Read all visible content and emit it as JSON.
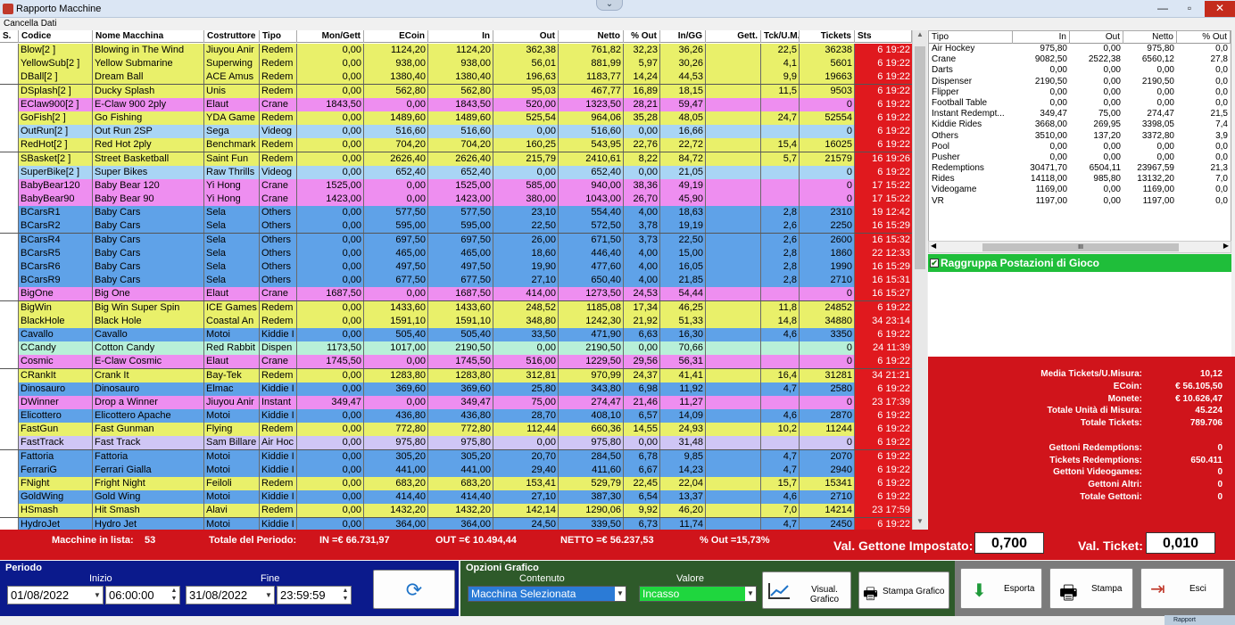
{
  "window": {
    "title": "Rapporto Macchine",
    "cancella": "Cancella Dati",
    "minimize": "—",
    "maximize": "▫",
    "close": "✕",
    "collapse": "⌄"
  },
  "grid": {
    "headers": [
      "S.",
      "Codice",
      "Nome Macchina",
      "Costruttore",
      "Tipo",
      "Mon/Gett",
      "ECoin",
      "In",
      "Out",
      "Netto",
      "% Out",
      "In/GG",
      "Gett.",
      "Tck/U.M.",
      "Tickets",
      "Sts"
    ],
    "rows": [
      {
        "color": "#e9f06a",
        "c": [
          "",
          "Blow[2 ]",
          "Blowing in The Wind",
          "Jiuyou Anir",
          "Redem",
          "0,00",
          "1124,20",
          "1124,20",
          "362,38",
          "761,82",
          "32,23",
          "36,26",
          "",
          "22,5",
          "36238",
          "6 19:22"
        ]
      },
      {
        "color": "#e9f06a",
        "c": [
          "",
          "YellowSub[2 ]",
          "Yellow Submarine",
          "Superwing",
          "Redem",
          "0,00",
          "938,00",
          "938,00",
          "56,01",
          "881,99",
          "5,97",
          "30,26",
          "",
          "4,1",
          "5601",
          "6 19:22"
        ]
      },
      {
        "color": "#e9f06a",
        "c": [
          "",
          "DBall[2 ]",
          "Dream Ball",
          "ACE Amus",
          "Redem",
          "0,00",
          "1380,40",
          "1380,40",
          "196,63",
          "1183,77",
          "14,24",
          "44,53",
          "",
          "9,9",
          "19663",
          "6 19:22"
        ]
      },
      {
        "color": "#e9f06a",
        "c": [
          "",
          "DSplash[2 ]",
          "Ducky Splash",
          "Unis",
          "Redem",
          "0,00",
          "562,80",
          "562,80",
          "95,03",
          "467,77",
          "16,89",
          "18,15",
          "",
          "11,5",
          "9503",
          "6 19:22"
        ]
      },
      {
        "color": "#ee8ef0",
        "c": [
          "",
          "EClaw900[2 ]",
          "E-Claw 900 2ply",
          "Elaut",
          "Crane",
          "1843,50",
          "0,00",
          "1843,50",
          "520,00",
          "1323,50",
          "28,21",
          "59,47",
          "",
          "",
          "0",
          "6 19:22"
        ]
      },
      {
        "color": "#e9f06a",
        "c": [
          "",
          "GoFish[2 ]",
          "Go Fishing",
          "YDA Game",
          "Redem",
          "0,00",
          "1489,60",
          "1489,60",
          "525,54",
          "964,06",
          "35,28",
          "48,05",
          "",
          "24,7",
          "52554",
          "6 19:22"
        ]
      },
      {
        "color": "#a9d5f5",
        "c": [
          "",
          "OutRun[2 ]",
          "Out Run 2SP",
          "Sega",
          "Videog",
          "0,00",
          "516,60",
          "516,60",
          "0,00",
          "516,60",
          "0,00",
          "16,66",
          "",
          "",
          "0",
          "6 19:22"
        ]
      },
      {
        "color": "#e9f06a",
        "c": [
          "",
          "RedHot[2 ]",
          "Red Hot 2ply",
          "Benchmark",
          "Redem",
          "0,00",
          "704,20",
          "704,20",
          "160,25",
          "543,95",
          "22,76",
          "22,72",
          "",
          "15,4",
          "16025",
          "6 19:22"
        ]
      },
      {
        "color": "#e9f06a",
        "c": [
          "",
          "SBasket[2 ]",
          "Street Basketball",
          "Saint Fun",
          "Redem",
          "0,00",
          "2626,40",
          "2626,40",
          "215,79",
          "2410,61",
          "8,22",
          "84,72",
          "",
          "5,7",
          "21579",
          "16 19:26"
        ]
      },
      {
        "color": "#a9d5f5",
        "c": [
          "",
          "SuperBike[2 ]",
          "Super Bikes",
          "Raw Thrills",
          "Videog",
          "0,00",
          "652,40",
          "652,40",
          "0,00",
          "652,40",
          "0,00",
          "21,05",
          "",
          "",
          "0",
          "6 19:22"
        ]
      },
      {
        "color": "#ee8ef0",
        "c": [
          "",
          "BabyBear120",
          "Baby Bear 120",
          "Yi Hong",
          "Crane",
          "1525,00",
          "0,00",
          "1525,00",
          "585,00",
          "940,00",
          "38,36",
          "49,19",
          "",
          "",
          "0",
          "17 15:22"
        ]
      },
      {
        "color": "#ee8ef0",
        "c": [
          "",
          "BabyBear90",
          "Baby Bear 90",
          "Yi Hong",
          "Crane",
          "1423,00",
          "0,00",
          "1423,00",
          "380,00",
          "1043,00",
          "26,70",
          "45,90",
          "",
          "",
          "0",
          "17 15:22"
        ]
      },
      {
        "color": "#5fa2e8",
        "c": [
          "",
          "BCarsR1",
          "Baby Cars",
          "Sela",
          "Others",
          "0,00",
          "577,50",
          "577,50",
          "23,10",
          "554,40",
          "4,00",
          "18,63",
          "",
          "2,8",
          "2310",
          "19 12:42"
        ]
      },
      {
        "color": "#5fa2e8",
        "c": [
          "",
          "BCarsR2",
          "Baby Cars",
          "Sela",
          "Others",
          "0,00",
          "595,00",
          "595,00",
          "22,50",
          "572,50",
          "3,78",
          "19,19",
          "",
          "2,6",
          "2250",
          "16 15:29"
        ]
      },
      {
        "color": "#5fa2e8",
        "c": [
          "",
          "BCarsR4",
          "Baby Cars",
          "Sela",
          "Others",
          "0,00",
          "697,50",
          "697,50",
          "26,00",
          "671,50",
          "3,73",
          "22,50",
          "",
          "2,6",
          "2600",
          "16 15:32"
        ]
      },
      {
        "color": "#5fa2e8",
        "c": [
          "",
          "BCarsR5",
          "Baby Cars",
          "Sela",
          "Others",
          "0,00",
          "465,00",
          "465,00",
          "18,60",
          "446,40",
          "4,00",
          "15,00",
          "",
          "2,8",
          "1860",
          "22 12:33"
        ]
      },
      {
        "color": "#5fa2e8",
        "c": [
          "",
          "BCarsR6",
          "Baby Cars",
          "Sela",
          "Others",
          "0,00",
          "497,50",
          "497,50",
          "19,90",
          "477,60",
          "4,00",
          "16,05",
          "",
          "2,8",
          "1990",
          "16 15:29"
        ]
      },
      {
        "color": "#5fa2e8",
        "c": [
          "",
          "BCarsR9",
          "Baby Cars",
          "Sela",
          "Others",
          "0,00",
          "677,50",
          "677,50",
          "27,10",
          "650,40",
          "4,00",
          "21,85",
          "",
          "2,8",
          "2710",
          "16 15:31"
        ]
      },
      {
        "color": "#ee8ef0",
        "c": [
          "",
          "BigOne",
          "Big One",
          "Elaut",
          "Crane",
          "1687,50",
          "0,00",
          "1687,50",
          "414,00",
          "1273,50",
          "24,53",
          "54,44",
          "",
          "",
          "0",
          "16 15:27"
        ]
      },
      {
        "color": "#e9f06a",
        "c": [
          "",
          "BigWin",
          "Big Win Super Spin",
          "ICE Games",
          "Redem",
          "0,00",
          "1433,60",
          "1433,60",
          "248,52",
          "1185,08",
          "17,34",
          "46,25",
          "",
          "11,8",
          "24852",
          "6 19:22"
        ]
      },
      {
        "color": "#e9f06a",
        "c": [
          "",
          "BlackHole",
          "Black Hole",
          "Coastal An",
          "Redem",
          "0,00",
          "1591,10",
          "1591,10",
          "348,80",
          "1242,30",
          "21,92",
          "51,33",
          "",
          "14,8",
          "34880",
          "34 23:14"
        ]
      },
      {
        "color": "#5fa2e8",
        "c": [
          "",
          "Cavallo",
          "Cavallo",
          "Motoi",
          "Kiddie I",
          "0,00",
          "505,40",
          "505,40",
          "33,50",
          "471,90",
          "6,63",
          "16,30",
          "",
          "4,6",
          "3350",
          "6 19:22"
        ]
      },
      {
        "color": "#b8f0d8",
        "c": [
          "",
          "CCandy",
          "Cotton Candy",
          "Red Rabbit",
          "Dispen",
          "1173,50",
          "1017,00",
          "2190,50",
          "0,00",
          "2190,50",
          "0,00",
          "70,66",
          "",
          "",
          "0",
          "24 11:39"
        ]
      },
      {
        "color": "#ee8ef0",
        "c": [
          "",
          "Cosmic",
          "E-Claw Cosmic",
          "Elaut",
          "Crane",
          "1745,50",
          "0,00",
          "1745,50",
          "516,00",
          "1229,50",
          "29,56",
          "56,31",
          "",
          "",
          "0",
          "6 19:22"
        ]
      },
      {
        "color": "#e9f06a",
        "c": [
          "",
          "CRankIt",
          "Crank It",
          "Bay-Tek",
          "Redem",
          "0,00",
          "1283,80",
          "1283,80",
          "312,81",
          "970,99",
          "24,37",
          "41,41",
          "",
          "16,4",
          "31281",
          "34 21:21"
        ]
      },
      {
        "color": "#5fa2e8",
        "c": [
          "",
          "Dinosauro",
          "Dinosauro",
          "Elmac",
          "Kiddie I",
          "0,00",
          "369,60",
          "369,60",
          "25,80",
          "343,80",
          "6,98",
          "11,92",
          "",
          "4,7",
          "2580",
          "6 19:22"
        ]
      },
      {
        "color": "#ee8ef0",
        "c": [
          "",
          "DWinner",
          "Drop a Winner",
          "Jiuyou Anir",
          "Instant",
          "349,47",
          "0,00",
          "349,47",
          "75,00",
          "274,47",
          "21,46",
          "11,27",
          "",
          "",
          "0",
          "23 17:39"
        ]
      },
      {
        "color": "#5fa2e8",
        "c": [
          "",
          "Elicottero",
          "Elicottero Apache",
          "Motoi",
          "Kiddie I",
          "0,00",
          "436,80",
          "436,80",
          "28,70",
          "408,10",
          "6,57",
          "14,09",
          "",
          "4,6",
          "2870",
          "6 19:22"
        ]
      },
      {
        "color": "#e9f06a",
        "c": [
          "",
          "FastGun",
          "Fast Gunman",
          "Flying",
          "Redem",
          "0,00",
          "772,80",
          "772,80",
          "112,44",
          "660,36",
          "14,55",
          "24,93",
          "",
          "10,2",
          "11244",
          "6 19:22"
        ]
      },
      {
        "color": "#cfc6f5",
        "c": [
          "",
          "FastTrack",
          "Fast Track",
          "Sam Billare",
          "Air Hoc",
          "0,00",
          "975,80",
          "975,80",
          "0,00",
          "975,80",
          "0,00",
          "31,48",
          "",
          "",
          "0",
          "6 19:22"
        ]
      },
      {
        "color": "#5fa2e8",
        "c": [
          "",
          "Fattoria",
          "Fattoria",
          "Motoi",
          "Kiddie I",
          "0,00",
          "305,20",
          "305,20",
          "20,70",
          "284,50",
          "6,78",
          "9,85",
          "",
          "4,7",
          "2070",
          "6 19:22"
        ]
      },
      {
        "color": "#5fa2e8",
        "c": [
          "",
          "FerrariG",
          "Ferrari Gialla",
          "Motoi",
          "Kiddie I",
          "0,00",
          "441,00",
          "441,00",
          "29,40",
          "411,60",
          "6,67",
          "14,23",
          "",
          "4,7",
          "2940",
          "6 19:22"
        ]
      },
      {
        "color": "#e9f06a",
        "c": [
          "",
          "FNight",
          "Fright Night",
          "Feiloli",
          "Redem",
          "0,00",
          "683,20",
          "683,20",
          "153,41",
          "529,79",
          "22,45",
          "22,04",
          "",
          "15,7",
          "15341",
          "6 19:22"
        ]
      },
      {
        "color": "#5fa2e8",
        "c": [
          "",
          "GoldWing",
          "Gold Wing",
          "Motoi",
          "Kiddie I",
          "0,00",
          "414,40",
          "414,40",
          "27,10",
          "387,30",
          "6,54",
          "13,37",
          "",
          "4,6",
          "2710",
          "6 19:22"
        ]
      },
      {
        "color": "#e9f06a",
        "c": [
          "",
          "HSmash",
          "Hit Smash",
          "Alavi",
          "Redem",
          "0,00",
          "1432,20",
          "1432,20",
          "142,14",
          "1290,06",
          "9,92",
          "46,20",
          "",
          "7,0",
          "14214",
          "23 17:59"
        ]
      },
      {
        "color": "#5fa2e8",
        "c": [
          "",
          "HydroJet",
          "Hydro Jet",
          "Motoi",
          "Kiddie I",
          "0,00",
          "364,00",
          "364,00",
          "24,50",
          "339,50",
          "6,73",
          "11,74",
          "",
          "4,7",
          "2450",
          "6 19:22"
        ]
      }
    ]
  },
  "right_table": {
    "headers": [
      "Tipo",
      "In",
      "Out",
      "Netto",
      "% Out"
    ],
    "rows": [
      [
        "Air Hockey",
        "975,80",
        "0,00",
        "975,80",
        "0,0"
      ],
      [
        "Crane",
        "9082,50",
        "2522,38",
        "6560,12",
        "27,8"
      ],
      [
        "Darts",
        "0,00",
        "0,00",
        "0,00",
        "0,0"
      ],
      [
        "Dispenser",
        "2190,50",
        "0,00",
        "2190,50",
        "0,0"
      ],
      [
        "Flipper",
        "0,00",
        "0,00",
        "0,00",
        "0,0"
      ],
      [
        "Football Table",
        "0,00",
        "0,00",
        "0,00",
        "0,0"
      ],
      [
        "Instant Redempt...",
        "349,47",
        "75,00",
        "274,47",
        "21,5"
      ],
      [
        "Kiddie Rides",
        "3668,00",
        "269,95",
        "3398,05",
        "7,4"
      ],
      [
        "Others",
        "3510,00",
        "137,20",
        "3372,80",
        "3,9"
      ],
      [
        "Pool",
        "0,00",
        "0,00",
        "0,00",
        "0,0"
      ],
      [
        "Pusher",
        "0,00",
        "0,00",
        "0,00",
        "0,0"
      ],
      [
        "Redemptions",
        "30471,70",
        "6504,11",
        "23967,59",
        "21,3"
      ],
      [
        "Rides",
        "14118,00",
        "985,80",
        "13132,20",
        "7,0"
      ],
      [
        "Videogame",
        "1169,00",
        "0,00",
        "1169,00",
        "0,0"
      ],
      [
        "VR",
        "1197,00",
        "0,00",
        "1197,00",
        "0,0"
      ]
    ],
    "scroll_mark": "III",
    "raggruppa": "Raggruppa Postazioni di Gioco",
    "raggruppa_check": "✔"
  },
  "summary": [
    [
      "Media Tickets/U.Misura:",
      "10,12"
    ],
    [
      "ECoin:",
      "€ 56.105,50"
    ],
    [
      "Monete:",
      "€ 10.626,47"
    ],
    [
      "Totale Unità di Misura:",
      "45.224"
    ],
    [
      "Totale Tickets:",
      "789.706"
    ],
    [
      "",
      ""
    ],
    [
      "Gettoni Redemptions:",
      "0"
    ],
    [
      "Tickets Redemptions:",
      "650.411"
    ],
    [
      "Gettoni Videogames:",
      "0"
    ],
    [
      "Gettoni Altri:",
      "0"
    ],
    [
      "Totale Gettoni:",
      "0"
    ]
  ],
  "totals": {
    "macchine_label": "Macchine in lista:",
    "macchine": "53",
    "periodo": "Totale del Periodo:",
    "in": "IN =€ 66.731,97",
    "out": "OUT =€ 10.494,44",
    "netto": "NETTO =€ 56.237,53",
    "pout": "% Out =15,73%",
    "gettone_label": "Val. Gettone Impostato:",
    "gettone": "0,700",
    "ticket_label": "Val. Ticket:",
    "ticket": "0,010"
  },
  "periodo": {
    "title": "Periodo",
    "inizio_label": "Inizio",
    "fine_label": "Fine",
    "start_date": "01/08/2022",
    "start_time": "06:00:00",
    "end_date": "31/08/2022",
    "end_time": "23:59:59"
  },
  "opzioni": {
    "title": "Opzioni Grafico",
    "contenuto_label": "Contenuto",
    "valore_label": "Valore",
    "contenuto": "Macchina Selezionata",
    "valore": "Incasso",
    "visual": "Visual. Grafico",
    "stampa_grafico": "Stampa Grafico"
  },
  "actions": {
    "esporta": "Esporta",
    "stampa": "Stampa",
    "esci": "Esci"
  },
  "taskbar": "Rapport"
}
